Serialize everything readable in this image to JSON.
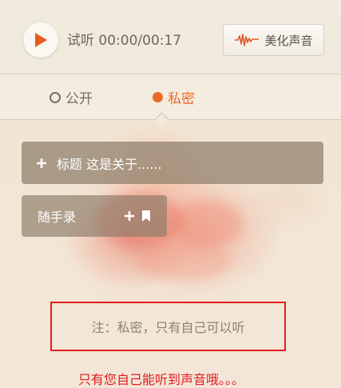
{
  "player": {
    "time_text": "试听 00:00/00:17",
    "beautify_label": "美化声音"
  },
  "tabs": [
    {
      "label": "公开",
      "selected": false
    },
    {
      "label": "私密",
      "selected": true
    }
  ],
  "actions": {
    "title_label": "标题 这是关于......",
    "memo_label": "随手录"
  },
  "note": {
    "text": "注：私密，只有自己可以听",
    "highlight_color": "#e01e1e"
  },
  "caption": "只有您自己能听到声音哦。。。",
  "colors": {
    "accent": "#ea6a2a",
    "caption": "#e11b1b"
  }
}
